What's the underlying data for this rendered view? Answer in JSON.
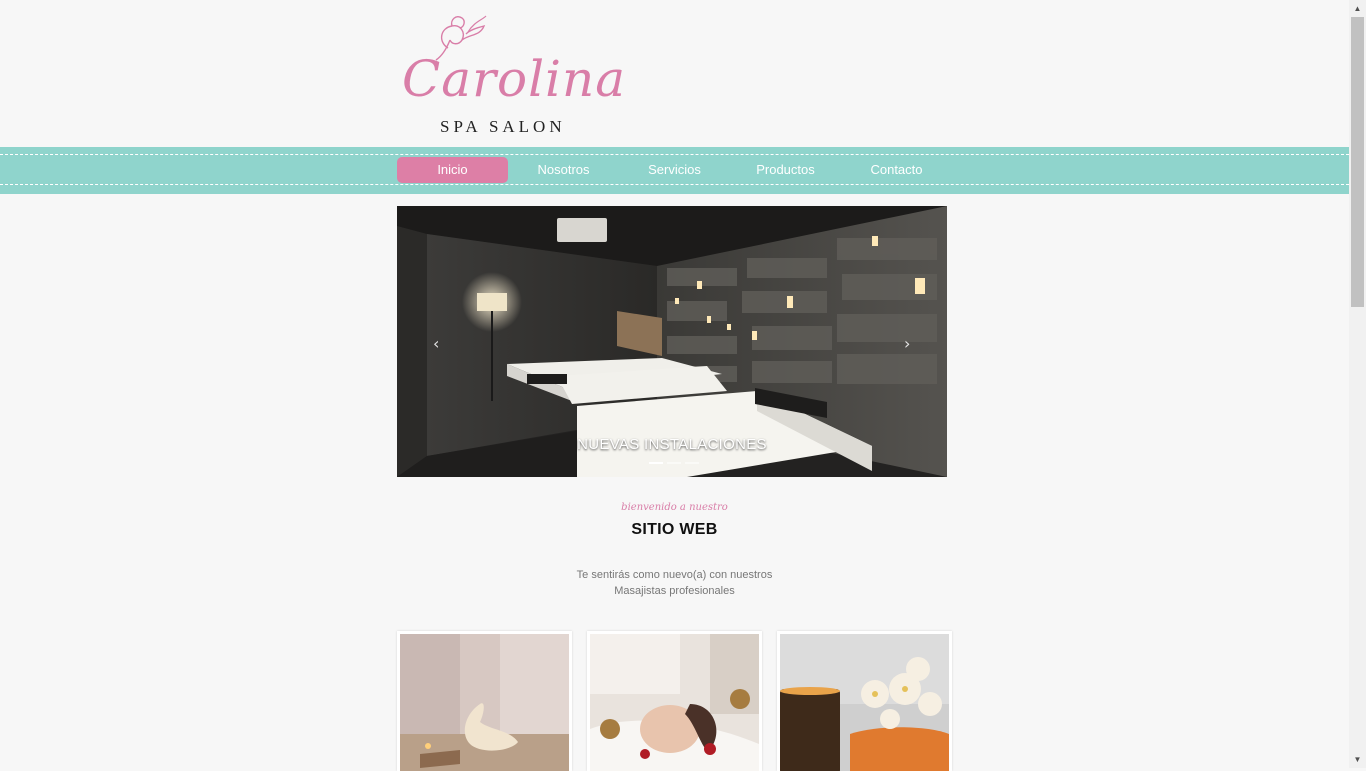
{
  "brand": {
    "name_script": "Carolina",
    "subtitle": "SPA SALON",
    "color": "#d97ea8"
  },
  "nav": {
    "items": [
      "Inicio",
      "Nosotros",
      "Servicios",
      "Productos",
      "Contacto"
    ],
    "active": "Inicio",
    "bar_color": "#8fd4cc",
    "active_color": "#dd7fa6"
  },
  "slider": {
    "caption": "NUEVAS INSTALACIONES",
    "prev_icon": "chevron-left-icon",
    "next_icon": "chevron-right-icon",
    "slide_count": 3,
    "active_slide": 1,
    "prev_glyph": "‹",
    "next_glyph": "›"
  },
  "welcome": {
    "script": "bienvenido a nuestro",
    "title": "SITIO WEB",
    "line1": "Te sentirás como nuevo(a) con nuestros",
    "line2": "Masajistas profesionales"
  },
  "cards": [
    "towel-swan-photo",
    "facial-massage-photo",
    "orchid-candle-photo"
  ],
  "scrollbar": {
    "up_glyph": "▲",
    "down_glyph": "▼"
  }
}
